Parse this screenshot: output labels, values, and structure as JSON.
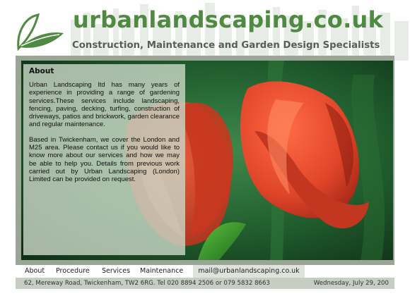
{
  "header": {
    "title": "urbanlandscaping.co.uk",
    "tagline": "Construction, Maintenance and Garden Design Specialists",
    "logo_icon": "leaf-logo"
  },
  "about": {
    "heading": "About",
    "paragraphs": [
      "Urban Landscaping ltd has many years of experience in providing a range of gardening services.These services include landscaping, fencing, paving, decking, turfing, construction of driveways, patios and brickwork, garden clearance and regular maintenance.",
      "Based in Twickenham, we cover the London and M25 area. Please contact us if you would like to know more about our services and how we may be able to help you. Details from previous work carried out by Urban Landscaping (London) Limited can be provided on request."
    ]
  },
  "photo": {
    "subject": "red tulips",
    "colors": {
      "petal": "#e0452a",
      "background": "#1f5a2c"
    }
  },
  "nav": {
    "items": [
      "About",
      "Procedure",
      "Services",
      "Maintenance"
    ],
    "email": "mail@urbanlandscaping.co.uk"
  },
  "footer": {
    "address": "62, Mereway Road, Twickenham, TW2 6RG. Tel 020 8894 2506 or 079 5832 8663",
    "date": "Wednesday, July 29, 200"
  },
  "colors": {
    "brand": "#4f8a41",
    "tagline": "#555f55",
    "footer_bg": "#c6cdc2"
  }
}
